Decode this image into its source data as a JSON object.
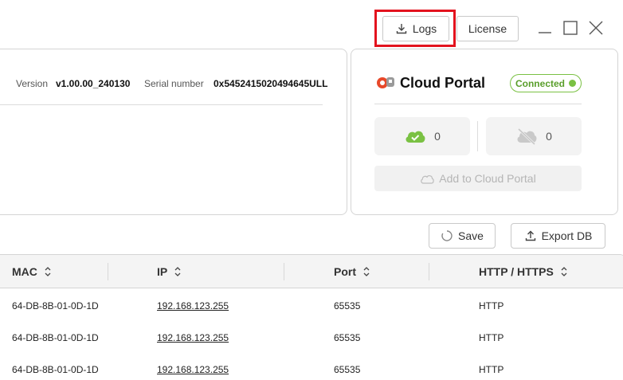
{
  "toolbar": {
    "logs_label": "Logs",
    "license_label": "License"
  },
  "info": {
    "version_label": "Version",
    "version_value": "v1.00.00_240130",
    "serial_label": "Serial number",
    "serial_value": "0x5452415020494645ULL"
  },
  "cloud": {
    "title": "Cloud Portal",
    "status": "Connected",
    "connected_count": "0",
    "disconnected_count": "0",
    "add_label": "Add to Cloud Portal"
  },
  "actions": {
    "save_label": "Save",
    "export_label": "Export DB"
  },
  "table": {
    "columns": [
      "MAC",
      "IP",
      "Port",
      "HTTP / HTTPS"
    ],
    "rows": [
      [
        "64-DB-8B-01-0D-1D",
        "192.168.123.255",
        "65535",
        "HTTP"
      ],
      [
        "64-DB-8B-01-0D-1D",
        "192.168.123.255",
        "65535",
        "HTTP"
      ],
      [
        "64-DB-8B-01-0D-1D",
        "192.168.123.255",
        "65535",
        "HTTP"
      ]
    ]
  },
  "colors": {
    "highlight": "#e3131e",
    "accent_green": "#7ac143",
    "brand_orange": "#e8492a"
  }
}
